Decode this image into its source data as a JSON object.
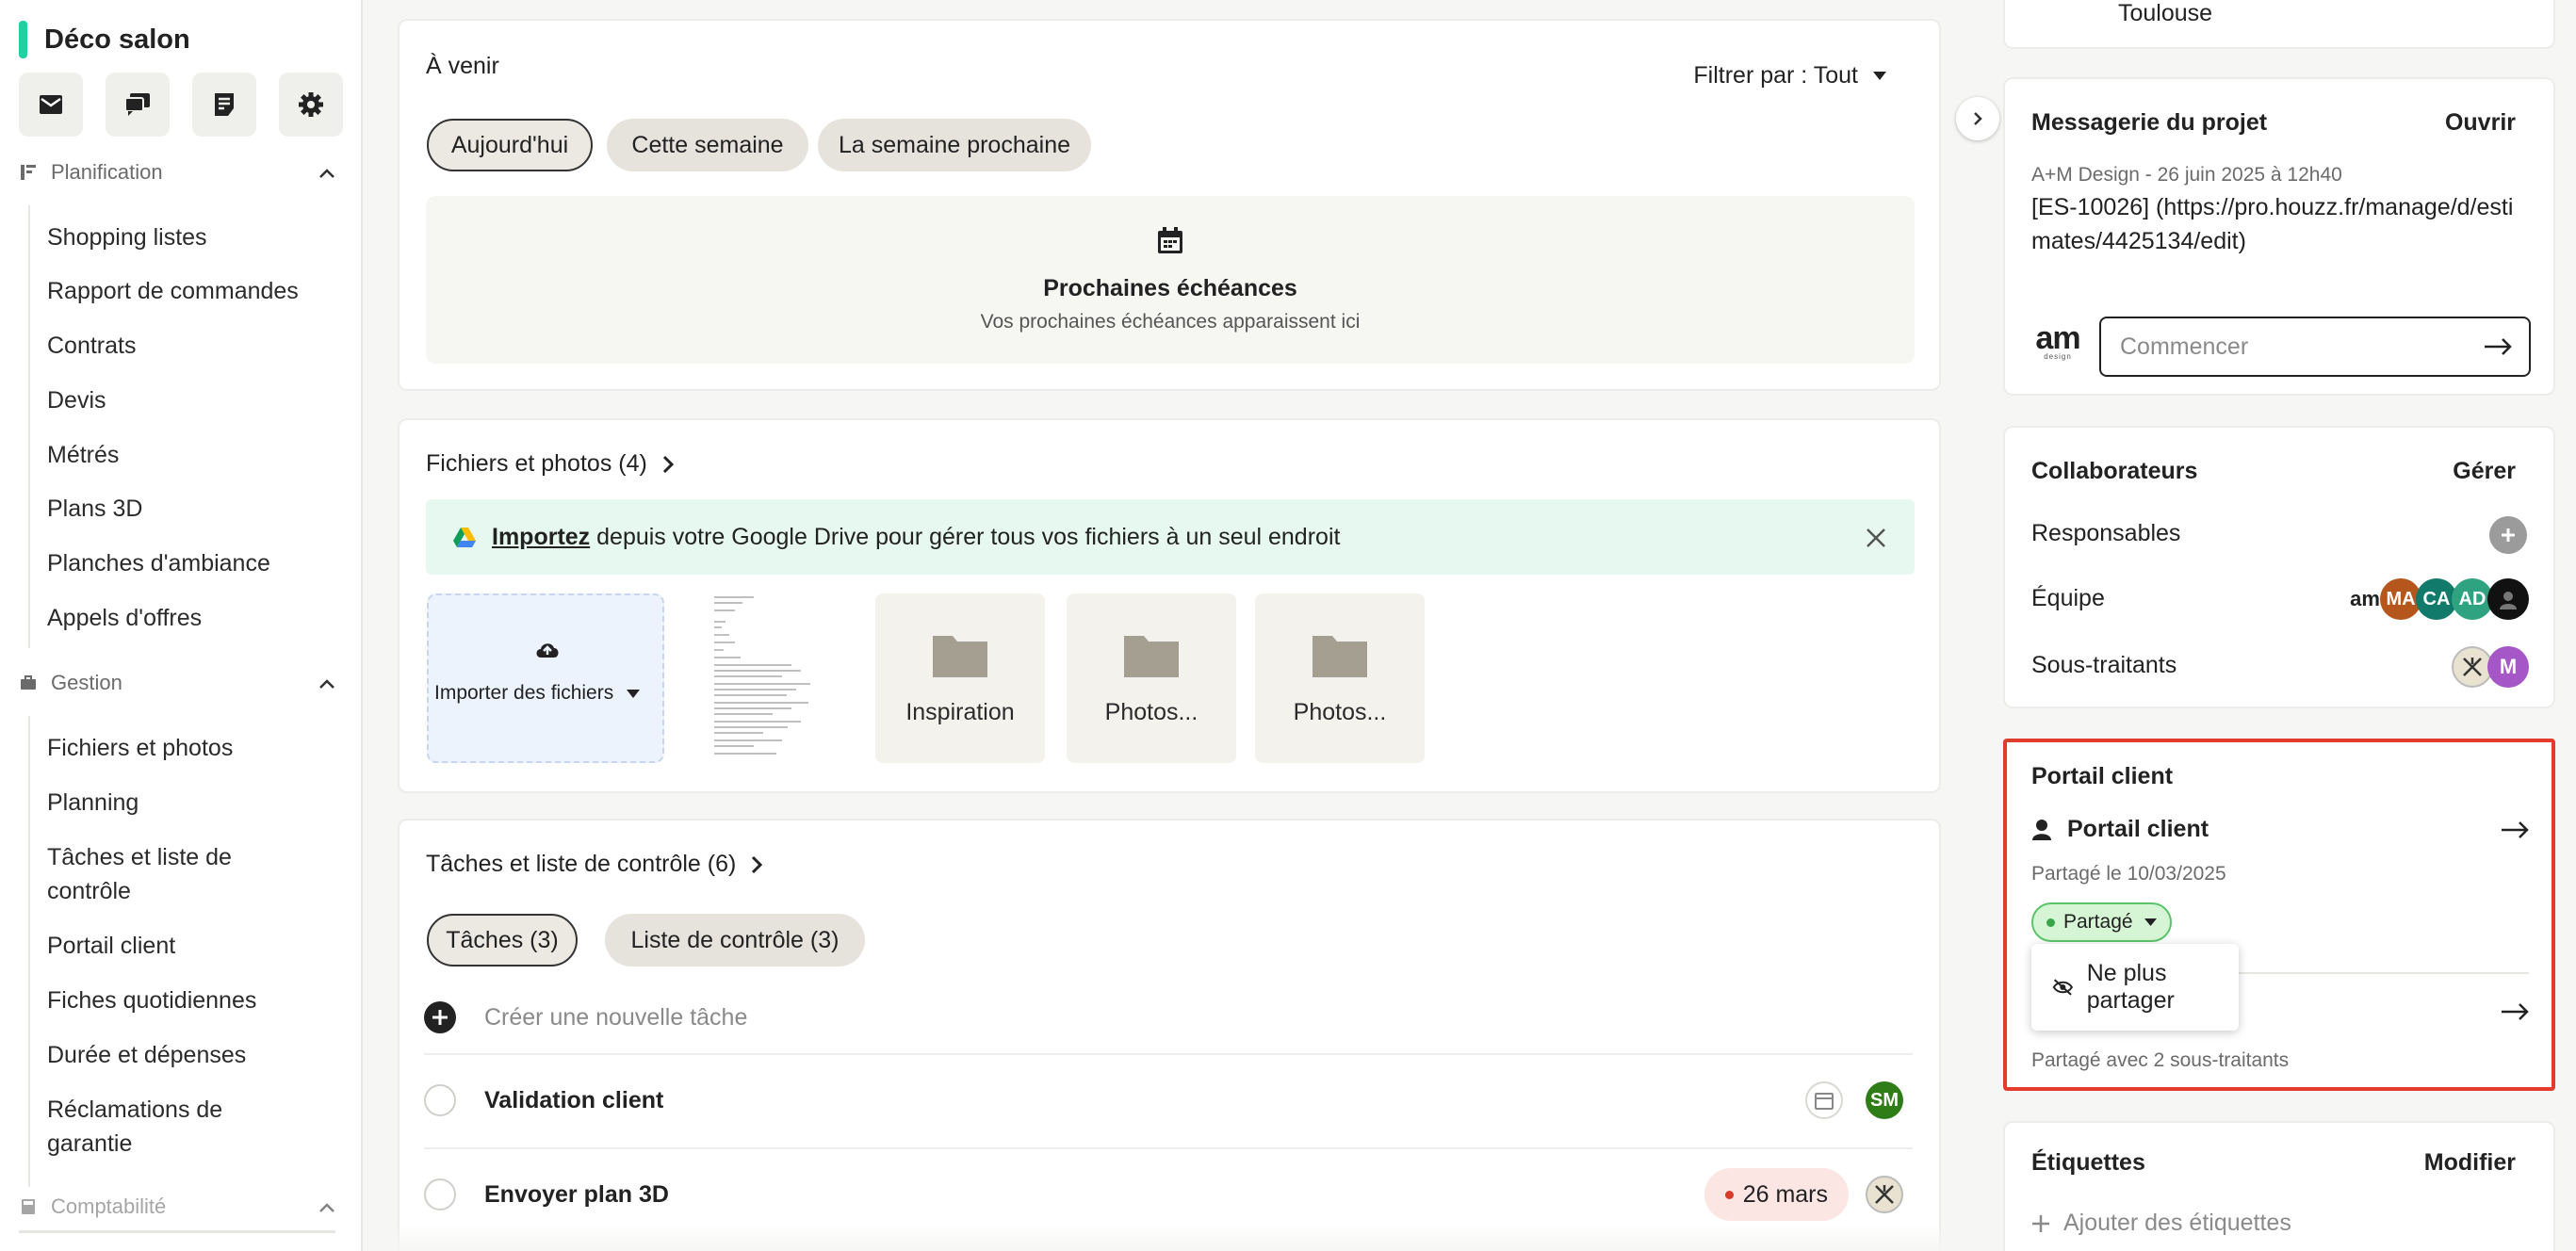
{
  "sidebar": {
    "project_name": "Déco salon",
    "accent_color": "#1fd0a0",
    "tools": [
      "mail-icon",
      "chat-icon",
      "notes-icon",
      "gear-icon"
    ],
    "sections": [
      {
        "title": "Planification",
        "items": [
          "Shopping listes",
          "Rapport de commandes",
          "Contrats",
          "Devis",
          "Métrés",
          "Plans 3D",
          "Planches d'ambiance",
          "Appels d'offres"
        ]
      },
      {
        "title": "Gestion",
        "items": [
          "Fichiers et photos",
          "Planning",
          "Tâches et liste de contrôle",
          "Portail client",
          "Fiches quotidiennes",
          "Durée et dépenses",
          "Réclamations de garantie"
        ]
      },
      {
        "title": "Comptabilité",
        "items": []
      }
    ]
  },
  "upcoming": {
    "title": "À venir",
    "filter_label": "Filtrer par : Tout",
    "pills": [
      "Aujourd'hui",
      "Cette semaine",
      "La semaine prochaine"
    ],
    "empty_title": "Prochaines échéances",
    "empty_sub": "Vos prochaines échéances apparaissent ici"
  },
  "files": {
    "title": "Fichiers et photos (4)",
    "banner_link": "Importez",
    "banner_text": " depuis votre Google Drive pour gérer tous vos fichiers à un seul endroit",
    "import_label": "Importer des fichiers",
    "folders": [
      "Inspiration",
      "Photos...",
      "Photos..."
    ]
  },
  "tasks": {
    "title": "Tâches et liste de contrôle (6)",
    "pills": [
      "Tâches (3)",
      "Liste de contrôle (3)"
    ],
    "new_task_placeholder": "Créer une nouvelle tâche",
    "rows": [
      {
        "name": "Validation client",
        "avatar": "SM"
      },
      {
        "name": "Envoyer plan 3D",
        "date": "26 mars"
      }
    ]
  },
  "right": {
    "top_city": "Toulouse",
    "messaging": {
      "title": "Messagerie du projet",
      "open_label": "Ouvrir",
      "meta": "A+M Design - 26 juin 2025 à 12h40",
      "message": "[ES-10026] (https://pro.houzz.fr/manage/d/estimates/4425134/edit)",
      "logo_text": "am",
      "logo_sub": "design",
      "input_placeholder": "Commencer"
    },
    "collaborators": {
      "title": "Collaborateurs",
      "manage_label": "Gérer",
      "rows": [
        "Responsables",
        "Équipe",
        "Sous-traitants"
      ],
      "team_avatars": [
        "am",
        "MA",
        "CA",
        "AD"
      ],
      "sub_avatar": "M"
    },
    "portal": {
      "title": "Portail client",
      "item_label": "Portail client",
      "shared_date": "Partagé le 10/03/2025",
      "status": "Partagé",
      "menu_item": "Ne plus partager",
      "shared_with": "Partagé avec 2 sous-traitants",
      "highlight_color": "#e53b2c"
    },
    "labels": {
      "title": "Étiquettes",
      "edit_label": "Modifier",
      "add_label": "Ajouter des étiquettes"
    }
  }
}
